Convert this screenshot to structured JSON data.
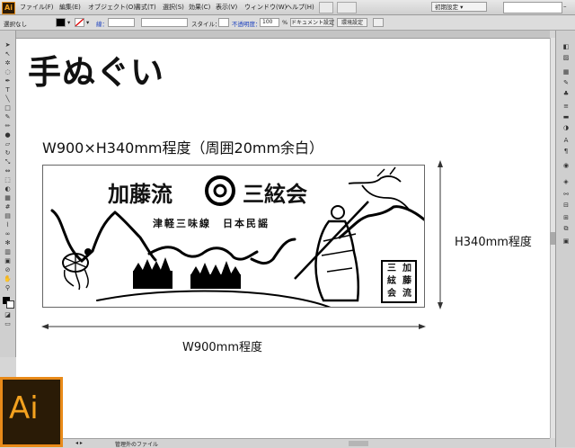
{
  "menubar": {
    "app_logo": "Ai",
    "items": [
      "ファイル(F)",
      "編集(E)",
      "オブジェクト(O)",
      "書式(T)",
      "選択(S)",
      "効果(C)",
      "表示(V)",
      "ウィンドウ(W)",
      "ヘルプ(H)"
    ],
    "workspace": "初期設定 ▾"
  },
  "controlbar": {
    "selection": "選択なし",
    "stroke_label": "線：",
    "style_label": "スタイル：",
    "opacity_label": "不透明度：",
    "opacity_value": "100",
    "opacity_unit": "%",
    "document_setup": "ドキュメント設定",
    "preferences": "環境設定"
  },
  "canvas": {
    "title": "手ぬぐい",
    "size_caption": "W900×H340mm程度（周囲20mm余白）",
    "height_label": "H340mm程度",
    "width_label": "W900mm程度"
  },
  "artwork": {
    "main_text": "加藤流",
    "sub_title": "三絃会",
    "subtitle_line": "津軽三味線　日本民謡",
    "seal_lines": [
      "加藤流",
      "三絃会"
    ]
  },
  "statusbar": {
    "status_text": "管理外のファイル"
  },
  "ai_logo": "Ai",
  "colors": {
    "accent": "#e88a19",
    "logo_bg": "#2a1b06"
  }
}
